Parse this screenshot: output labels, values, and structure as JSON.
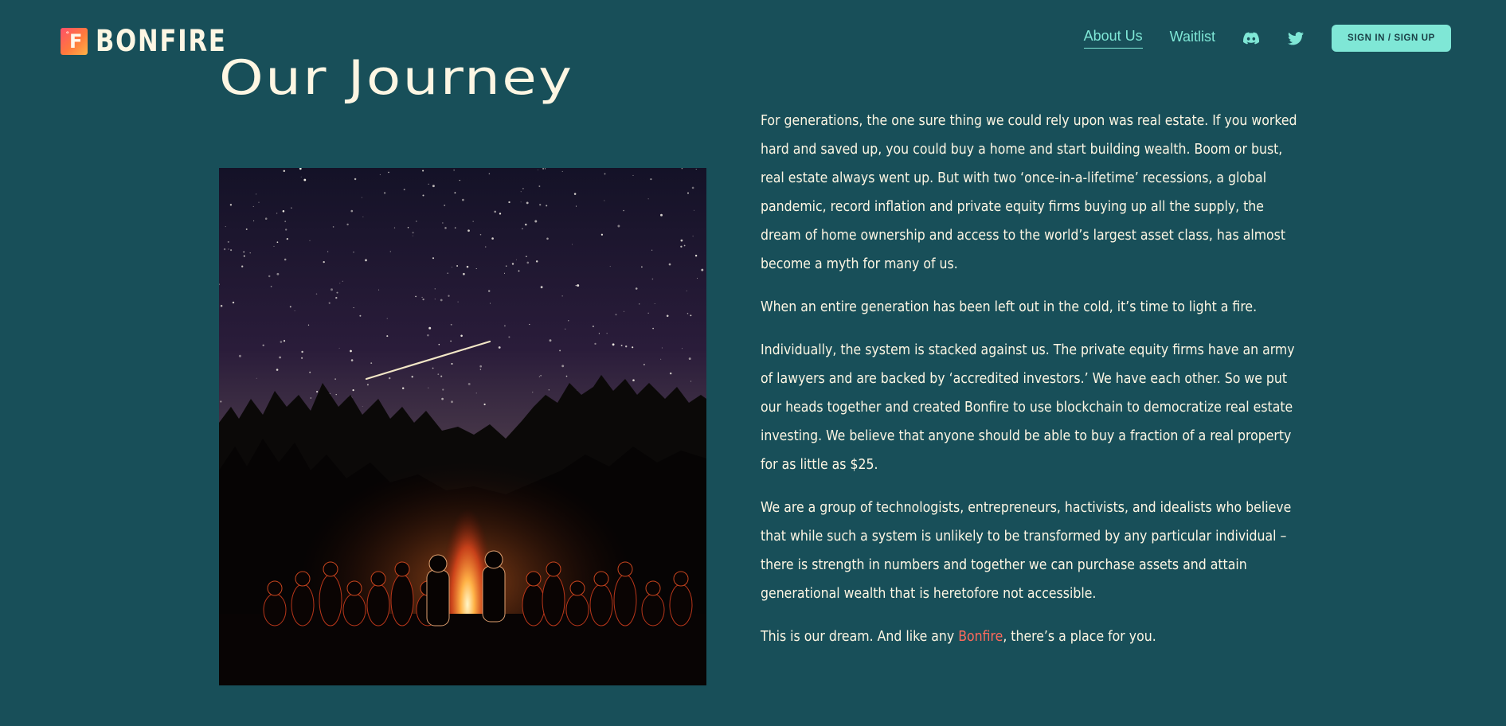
{
  "brand": {
    "logo_mark": "F",
    "logo_text": "BONFIRE"
  },
  "nav": {
    "items": [
      {
        "label": "About Us",
        "active": true
      },
      {
        "label": "Waitlist",
        "active": false
      }
    ],
    "icons": [
      "discord-icon",
      "twitter-icon"
    ],
    "signin_label": "SIGN IN / SIGN UP"
  },
  "page": {
    "title": "Our Journey"
  },
  "copy": {
    "p1": "For generations, the one sure thing we could rely upon was real estate. If you worked hard and saved up, you could buy a  home and start building wealth. Boom or bust, real estate always went up. But with two ‘once-in-a-lifetime’ recessions, a global pandemic, record inflation and private equity firms buying up all the supply, the dream of home ownership and access to the world’s largest asset class, has almost become a myth for many of us.",
    "p2": "When an entire generation has been left out in the cold, it’s time to light a fire.",
    "p3": "Individually, the system is stacked against us. The private equity firms have an army of lawyers and are backed by ‘accredited investors.’ We have each other. So we put our heads together and created Bonfire to use blockchain to democratize real estate investing. We believe that anyone should be able to buy a fraction of a real property for as little as $25.",
    "p4": "We are a group of technologists, entrepreneurs, hactivists, and idealists who believe that while such a system is unlikely to be transformed by any particular individual – there is strength in numbers and together we can purchase assets and attain generational wealth that is heretofore not accessible.",
    "p5_before": "This is our dream. And like any ",
    "p5_link": "Bonfire",
    "p5_after": ", there’s a place for you."
  },
  "colors": {
    "background": "#184f59",
    "accent": "#7fe7d6",
    "text": "#fdf6e3",
    "link_highlight": "#ff6a5c"
  }
}
